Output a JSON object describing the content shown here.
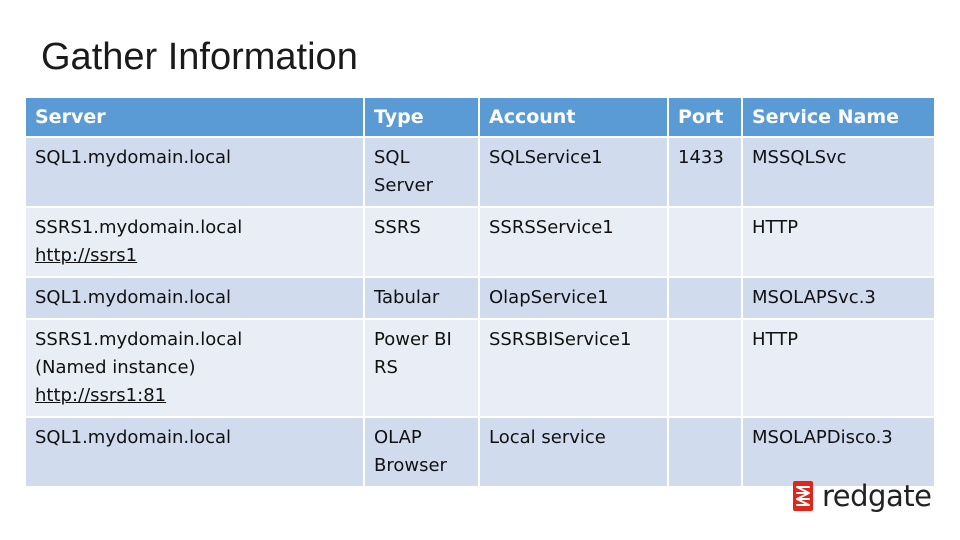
{
  "slide": {
    "title": "Gather Information"
  },
  "table": {
    "headers": [
      "Server",
      "Type",
      "Account",
      "Port",
      "Service Name"
    ],
    "rows": [
      {
        "server": [
          "SQL1.mydomain.local"
        ],
        "server_link": "",
        "type": [
          "SQL",
          "Server"
        ],
        "account": "SQLService1",
        "port": "1433",
        "service_name": "MSSQLSvc"
      },
      {
        "server": [
          "SSRS1.mydomain.local"
        ],
        "server_link": "http://ssrs1",
        "type": [
          "SSRS"
        ],
        "account": "SSRSService1",
        "port": "",
        "service_name": "HTTP"
      },
      {
        "server": [
          "SQL1.mydomain.local"
        ],
        "server_link": "",
        "type": [
          "Tabular"
        ],
        "account": "OlapService1",
        "port": "",
        "service_name": "MSOLAPSvc.3"
      },
      {
        "server": [
          "SSRS1.mydomain.local",
          "(Named instance)"
        ],
        "server_link": "http://ssrs1:81",
        "type": [
          "Power BI",
          "RS"
        ],
        "account": "SSRSBIService1",
        "port": "",
        "service_name": "HTTP"
      },
      {
        "server": [
          "SQL1.mydomain.local"
        ],
        "server_link": "",
        "type": [
          "OLAP",
          "Browser"
        ],
        "account": "Local service",
        "port": "",
        "service_name": "MSOLAPDisco.3"
      }
    ]
  },
  "logo": {
    "text": "redgate",
    "icon": "redgate-logo-icon",
    "color": "#e0251b"
  },
  "colors": {
    "header_bg": "#5b9bd5",
    "row_odd_bg": "#d0dcee",
    "row_even_bg": "#e9edf5"
  }
}
